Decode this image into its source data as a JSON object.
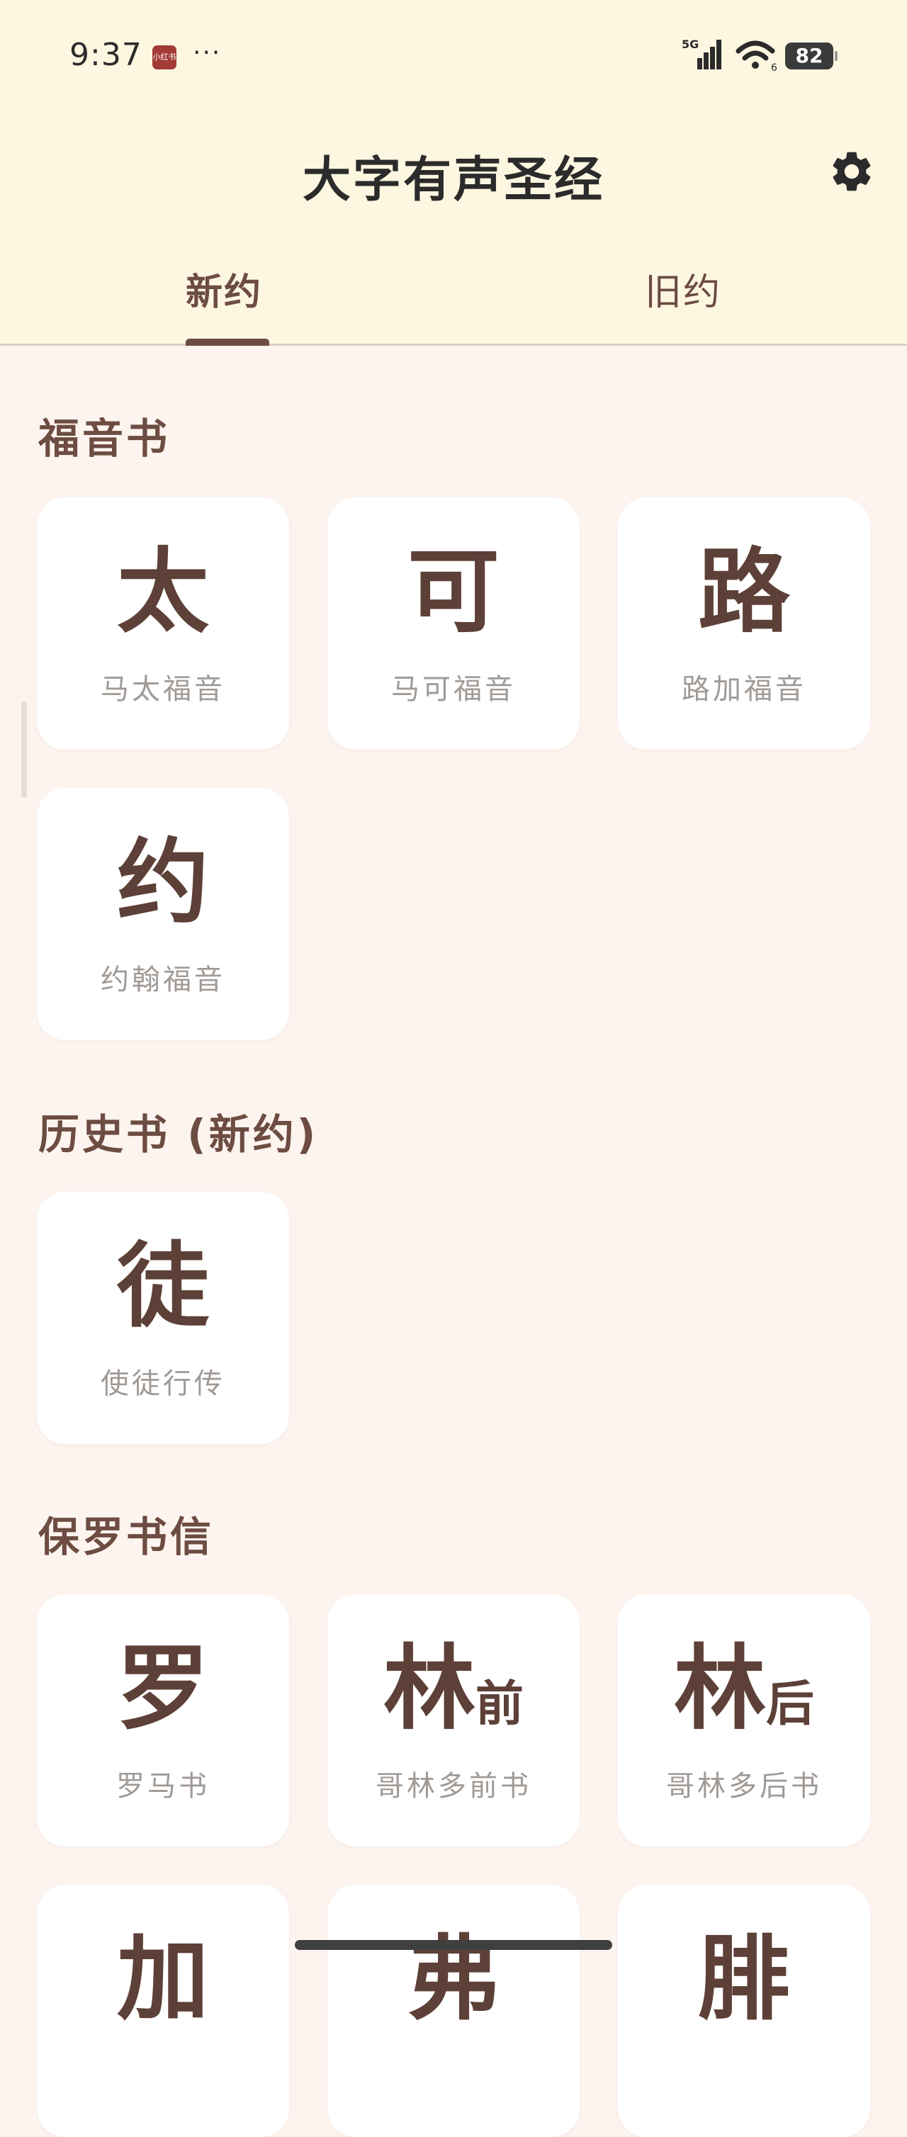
{
  "status_bar": {
    "time": "9:37",
    "app_badge": "小红书",
    "more": "···",
    "network": "5G",
    "wifi_sub": "6",
    "battery": "82"
  },
  "header": {
    "title": "大字有声圣经",
    "settings_icon": "gear-icon"
  },
  "tabs": [
    {
      "label": "新约",
      "active": true
    },
    {
      "label": "旧约",
      "active": false
    }
  ],
  "sections": [
    {
      "title": "福音书",
      "books": [
        {
          "glyph": "太",
          "suffix": "",
          "name": "马太福音"
        },
        {
          "glyph": "可",
          "suffix": "",
          "name": "马可福音"
        },
        {
          "glyph": "路",
          "suffix": "",
          "name": "路加福音"
        },
        {
          "glyph": "约",
          "suffix": "",
          "name": "约翰福音"
        }
      ]
    },
    {
      "title": "历史书 (新约)",
      "books": [
        {
          "glyph": "徒",
          "suffix": "",
          "name": "使徒行传"
        }
      ]
    },
    {
      "title": "保罗书信",
      "books": [
        {
          "glyph": "罗",
          "suffix": "",
          "name": "罗马书"
        },
        {
          "glyph": "林",
          "suffix": "前",
          "name": "哥林多前书"
        },
        {
          "glyph": "林",
          "suffix": "后",
          "name": "哥林多后书"
        },
        {
          "glyph": "加",
          "suffix": "",
          "name": ""
        },
        {
          "glyph": "弗",
          "suffix": "",
          "name": ""
        },
        {
          "glyph": "腓",
          "suffix": "",
          "name": ""
        }
      ]
    }
  ],
  "colors": {
    "header_bg": "#fdf7e1",
    "page_bg": "#fdf4ef",
    "accent_brown": "#5d4037",
    "muted_text": "#a09a96"
  }
}
